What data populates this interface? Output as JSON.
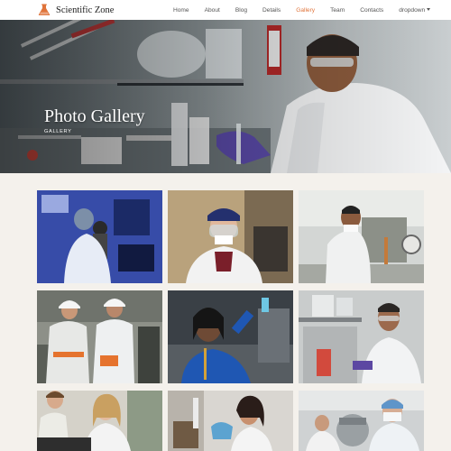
{
  "header": {
    "brand": "Scientific Zone",
    "brand_icon": "flask-icon",
    "accent_color": "#e0743b",
    "menu": [
      {
        "label": "Home",
        "active": false
      },
      {
        "label": "About",
        "active": false
      },
      {
        "label": "Blog",
        "active": false
      },
      {
        "label": "Details",
        "active": false
      },
      {
        "label": "Gallery",
        "active": true
      },
      {
        "label": "Team",
        "active": false
      },
      {
        "label": "Contacts",
        "active": false
      },
      {
        "label": "dropdown",
        "active": false,
        "has_caret": true
      }
    ]
  },
  "hero": {
    "title": "Photo Gallery",
    "subtitle": "GALLERY"
  },
  "gallery": {
    "images": [
      {
        "subject": "scientist-with-microscope"
      },
      {
        "subject": "researcher-with-face-shield"
      },
      {
        "subject": "chemist-with-lab-apparatus"
      },
      {
        "subject": "workers-in-hard-hats"
      },
      {
        "subject": "scientist-holding-flask"
      },
      {
        "subject": "chemist-with-goggles-and-flask"
      },
      {
        "subject": "students-at-lab-bench"
      },
      {
        "subject": "scientist-with-pipette"
      },
      {
        "subject": "researchers-in-masks"
      }
    ]
  }
}
